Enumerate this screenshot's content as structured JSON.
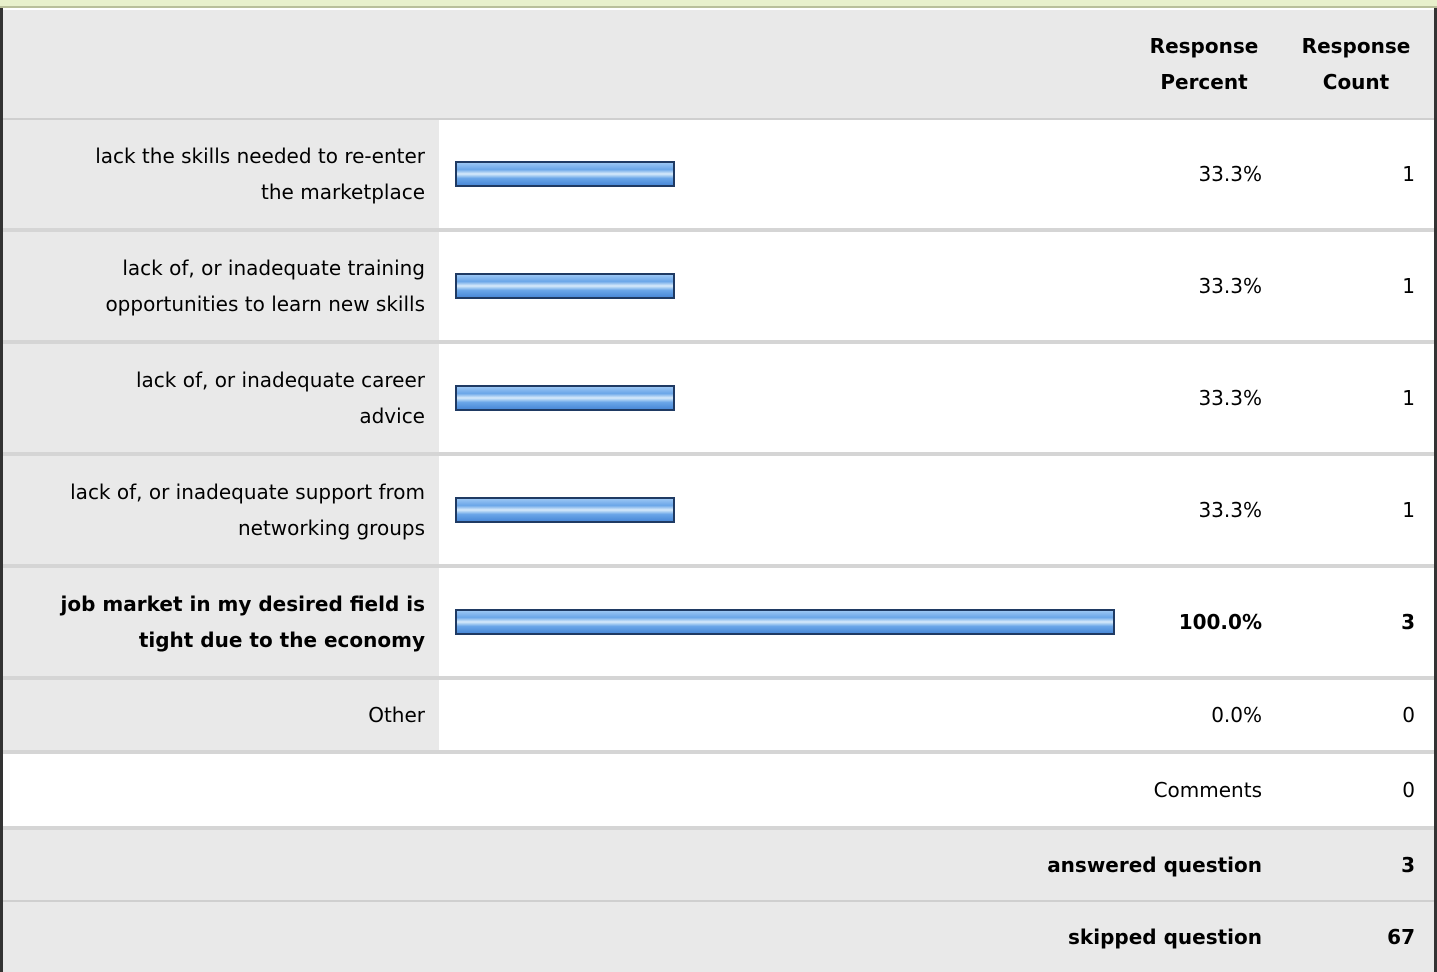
{
  "header": {
    "percent_label_1": "Response",
    "percent_label_2": "Percent",
    "count_label_1": "Response",
    "count_label_2": "Count"
  },
  "chart_data": {
    "type": "bar",
    "categories": [
      "lack the skills needed to re-enter the marketplace",
      "lack of, or inadequate training opportunities to learn new skills",
      "lack of, or inadequate career advice",
      "lack of, or inadequate support from networking groups",
      "job market in my desired field is tight due to the economy",
      "Other"
    ],
    "values": [
      33.3,
      33.3,
      33.3,
      33.3,
      100.0,
      0.0
    ],
    "xlim": [
      0,
      100
    ]
  },
  "rows": [
    {
      "label_1": "lack the skills needed to re-enter",
      "label_2": "the marketplace",
      "percent": "33.3%",
      "count": "1",
      "value": 33.3,
      "bold": false
    },
    {
      "label_1": "lack of, or inadequate training",
      "label_2": "opportunities to learn new skills",
      "percent": "33.3%",
      "count": "1",
      "value": 33.3,
      "bold": false
    },
    {
      "label_1": "lack of, or inadequate career",
      "label_2": "advice",
      "percent": "33.3%",
      "count": "1",
      "value": 33.3,
      "bold": false
    },
    {
      "label_1": "lack of, or inadequate support from",
      "label_2": "networking groups",
      "percent": "33.3%",
      "count": "1",
      "value": 33.3,
      "bold": false
    },
    {
      "label_1": "job market in my desired field is",
      "label_2": "tight due to the economy",
      "percent": "100.0%",
      "count": "3",
      "value": 100.0,
      "bold": true
    },
    {
      "label_1": "Other",
      "label_2": "",
      "percent": "0.0%",
      "count": "0",
      "value": 0.0,
      "bold": false
    }
  ],
  "comments": {
    "label": "Comments",
    "count": "0"
  },
  "answered": {
    "label": "answered question",
    "count": "3"
  },
  "skipped": {
    "label": "skipped question",
    "count": "67"
  },
  "colors": {
    "bar_fill": "#6aa6e8",
    "bar_border": "#1f3a63",
    "row_gray": "#e9e9e9",
    "top_strip": "#e8f0cc"
  }
}
